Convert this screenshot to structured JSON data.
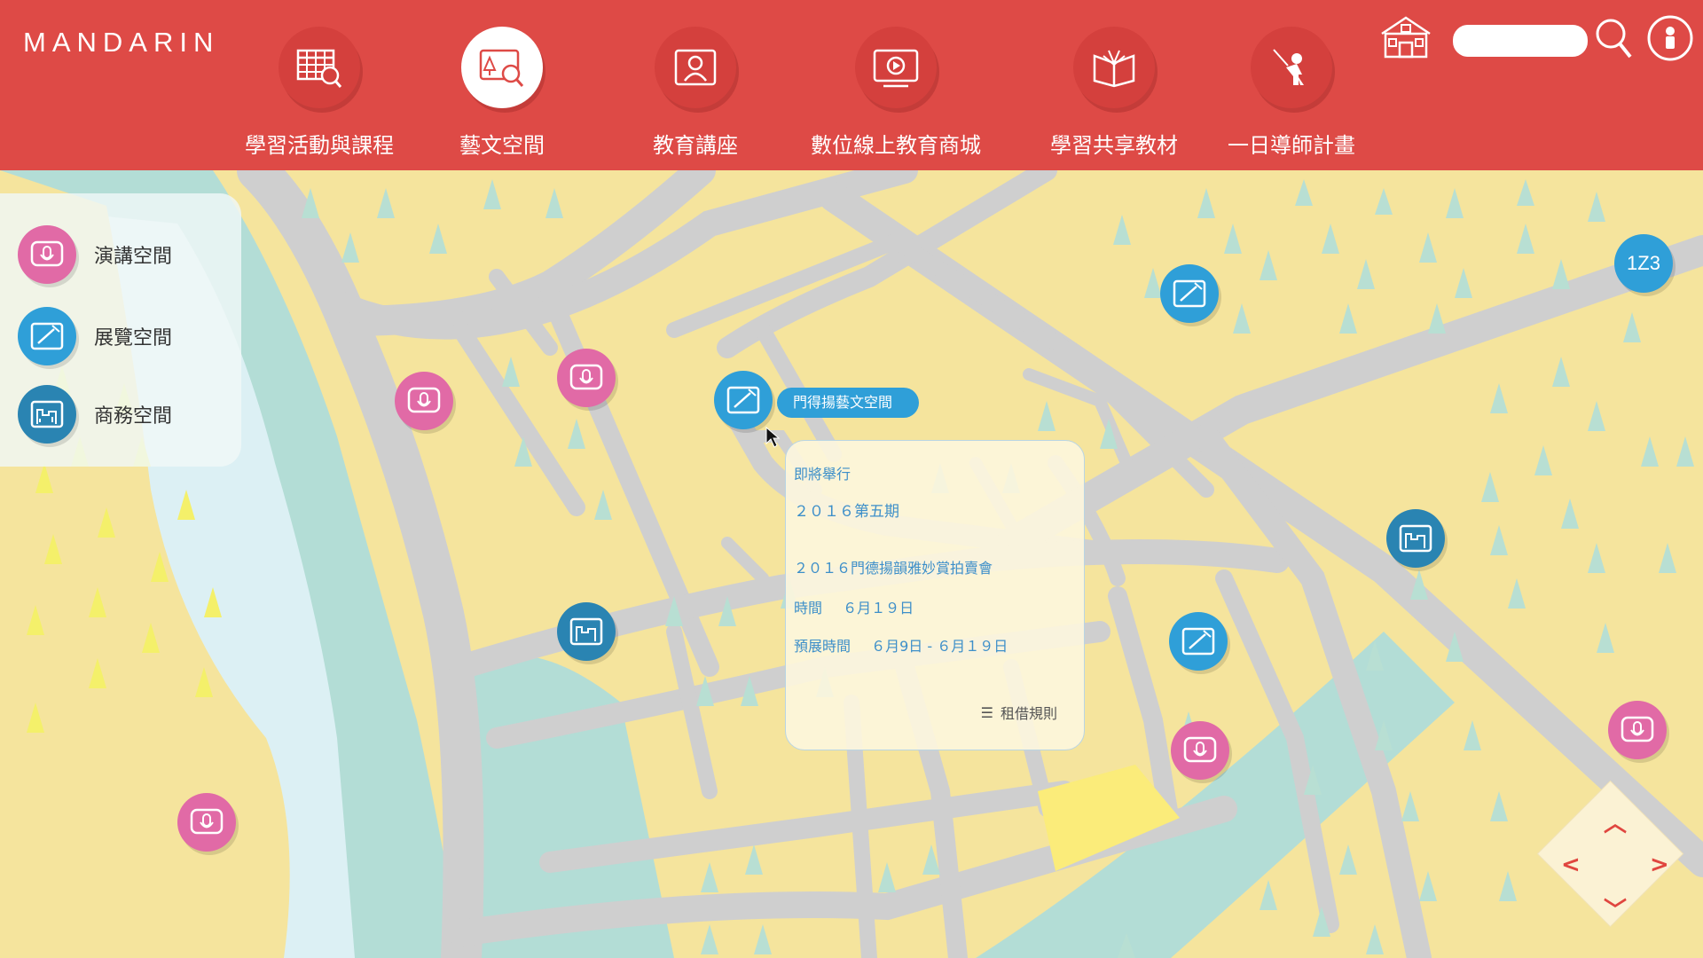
{
  "app": {
    "logo": "MANDARIN"
  },
  "nav": [
    {
      "label": "學習活動與課程",
      "icon": "calendar-search-icon",
      "active": false
    },
    {
      "label": "藝文空間",
      "icon": "gallery-search-icon",
      "active": true
    },
    {
      "label": "教育講座",
      "icon": "lecture-icon",
      "active": false
    },
    {
      "label": "數位線上教育商城",
      "icon": "video-play-icon",
      "active": false
    },
    {
      "label": "學習共享教材",
      "icon": "book-icon",
      "active": false
    },
    {
      "label": "一日導師計畫",
      "icon": "mentor-icon",
      "active": false
    }
  ],
  "top_right": {
    "home_icon": "home-icon",
    "search_placeholder": "",
    "search_icon": "search-icon",
    "user_icon": "user-icon"
  },
  "legend": [
    {
      "label": "演講空間",
      "icon": "microphone-icon",
      "color": "#e16aa6"
    },
    {
      "label": "展覽空間",
      "icon": "easel-icon",
      "color": "#2f9fd8"
    },
    {
      "label": "商務空間",
      "icon": "office-icon",
      "color": "#2a84b2"
    }
  ],
  "selected": {
    "name": "門得揚藝文空間"
  },
  "popup": {
    "upcoming_label": "即將舉行",
    "session": "２０１６第五期",
    "event_title": "２０１６門德揚韻雅妙賞拍賣會",
    "time_label": "時間",
    "time_value": "６月１９日",
    "preview_label": "預展時間",
    "preview_value": "６月9日 - ６月１９日",
    "rules_link": "租借規則"
  },
  "zoom_badge": "1Z3",
  "colors": {
    "header": "#de4a46",
    "pink": "#e16aa6",
    "blue": "#2f9fd8",
    "teal": "#2a84b2",
    "map_land": "#f5e49d",
    "map_road": "#cfcfcf",
    "map_water": "#b3ddd6"
  }
}
